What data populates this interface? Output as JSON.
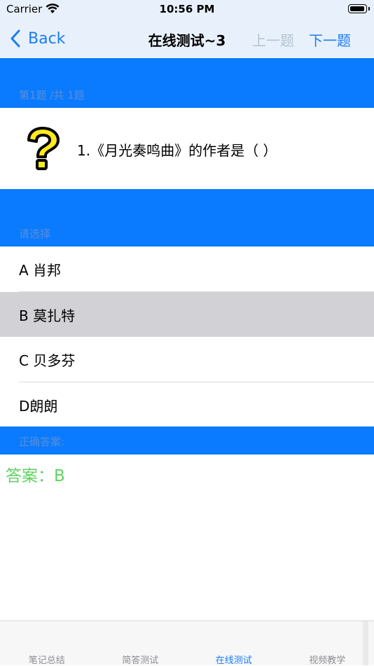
{
  "status_bar": {
    "carrier": "Carrier",
    "time": "10:56 PM"
  },
  "nav": {
    "back_label": "Back",
    "title": "在线测试~3",
    "prev_label": "上一题",
    "next_label": "下一题",
    "accent_color": "#1a7cf5",
    "disabled_color": "#b4c2d2"
  },
  "question_section": {
    "header": "第1题 /共 1题",
    "icon": "question-mark-icon",
    "question": "1.《月光奏鸣曲》的作者是（    ）"
  },
  "options_section": {
    "header": "请选择",
    "options": [
      {
        "label": "A 肖邦",
        "selected": false
      },
      {
        "label": "B 莫扎特",
        "selected": true
      },
      {
        "label": "C 贝多芬",
        "selected": false
      },
      {
        "label": "D朗朗",
        "selected": false
      }
    ]
  },
  "answer_section": {
    "header": "正确答案:",
    "answer": "答案：B",
    "answer_color": "#5fd35f"
  },
  "tab_bar": {
    "tabs": [
      {
        "label": "笔记总结",
        "active": false
      },
      {
        "label": "简答测试",
        "active": false
      },
      {
        "label": "在线测试",
        "active": true
      },
      {
        "label": "视频教学",
        "active": false
      }
    ]
  },
  "colors": {
    "section_blue": "#0a7afe",
    "selected_row": "#d2d1d6"
  }
}
